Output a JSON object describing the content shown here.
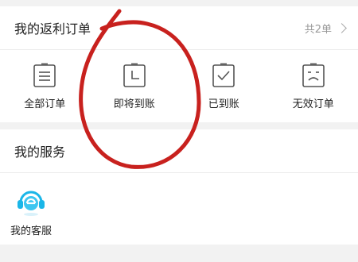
{
  "orders": {
    "title": "我的返利订单",
    "count_label": "共2单",
    "items": [
      {
        "label": "全部订单",
        "icon": "list-document-icon"
      },
      {
        "label": "即将到账",
        "icon": "clock-document-icon"
      },
      {
        "label": "已到账",
        "icon": "check-document-icon"
      },
      {
        "label": "无效订单",
        "icon": "sad-face-document-icon"
      }
    ]
  },
  "services": {
    "title": "我的服务",
    "items": [
      {
        "label": "我的客服",
        "icon": "customer-service-headset-icon"
      }
    ]
  },
  "colors": {
    "annotation": "#c8211e",
    "service_icon": "#1ab6e8",
    "icon_stroke": "#555555"
  }
}
